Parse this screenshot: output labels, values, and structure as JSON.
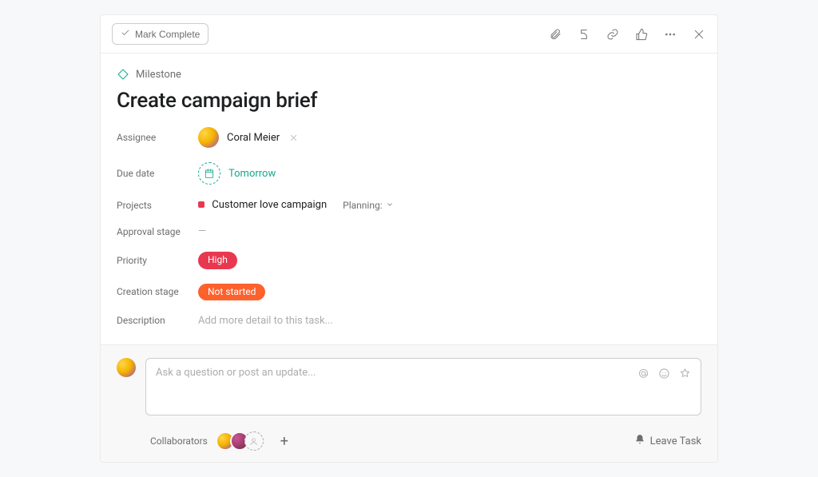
{
  "header": {
    "mark_complete_label": "Mark Complete"
  },
  "milestone": {
    "label": "Milestone"
  },
  "title": "Create campaign brief",
  "fields": {
    "assignee_label": "Assignee",
    "assignee_name": "Coral Meier",
    "due_date_label": "Due date",
    "due_date_value": "Tomorrow",
    "projects_label": "Projects",
    "project_name": "Customer love campaign",
    "section_label": "Planning:",
    "approval_stage_label": "Approval stage",
    "approval_stage_value": "—",
    "priority_label": "Priority",
    "priority_value": "High",
    "creation_stage_label": "Creation stage",
    "creation_stage_value": "Not started",
    "description_label": "Description",
    "description_placeholder": "Add more detail to this task..."
  },
  "comment": {
    "placeholder": "Ask a question or post an update..."
  },
  "footer": {
    "collaborators_label": "Collaborators",
    "leave_task_label": "Leave Task"
  }
}
